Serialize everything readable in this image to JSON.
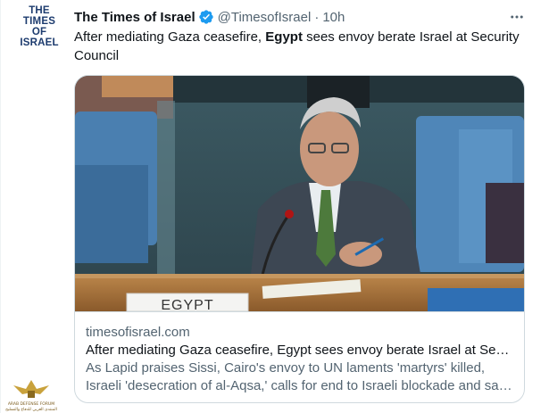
{
  "tweet": {
    "avatar_text": [
      "THE TIMES",
      "OF ISRAEL"
    ],
    "display_name": "The Times of Israel",
    "handle": "@TimesofIsrael",
    "separator": "·",
    "time": "10h",
    "text_parts": {
      "before": "After mediating Gaza ceasefire, ",
      "bold": "Egypt",
      "after": " sees envoy berate Israel at Security Council"
    }
  },
  "card": {
    "image_caption_sign": "EGYPT",
    "domain": "timesofisrael.com",
    "title": "After mediating Gaza ceasefire, Egypt sees envoy berate Israel at Sec…",
    "description": "As Lapid praises Sissi, Cairo's envoy to UN laments 'martyrs' killed, Israeli 'desecration of al-Aqsa,' calls for end to Israeli blockade and sa…"
  },
  "watermark": {
    "line1": "ARAB DEFENSE FORUM",
    "line2": "المنتدى العربي للدفاع والتسليح"
  },
  "colors": {
    "verified": "#1d9bf0",
    "secondary_text": "#536471",
    "border": "#cfd9de",
    "primary_text": "#0f1419"
  },
  "icons": {
    "verified": "verified-badge",
    "more": "more-horizontal",
    "watermark_emblem": "eagle-emblem"
  }
}
